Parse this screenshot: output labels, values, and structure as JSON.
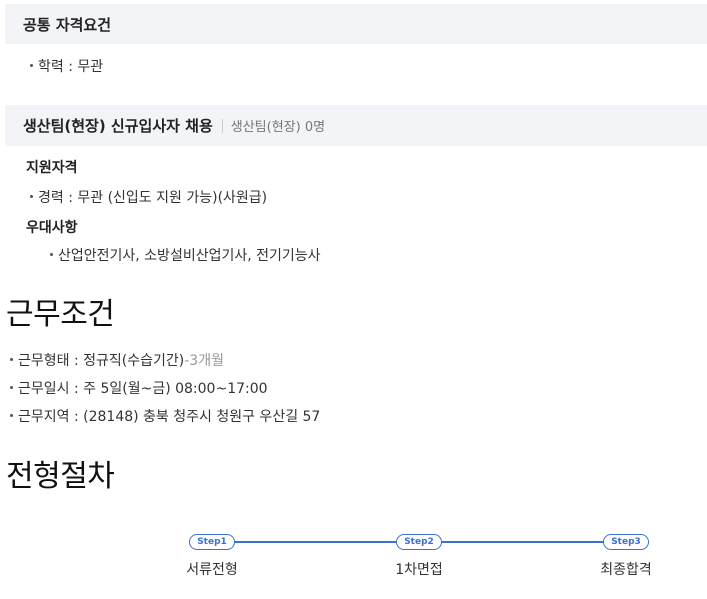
{
  "common": {
    "title": "공통 자격요건",
    "items": [
      "학력 : 무관"
    ]
  },
  "position": {
    "title": "생산팀(현장) 신규입사자 채용",
    "subtitle": "생산팀(현장) 0명",
    "qualification_heading": "지원자격",
    "qualification_items": [
      "경력 : 무관 (신입도 지원 가능)(사원급)"
    ],
    "preference_heading": "우대사항",
    "preference_items": [
      "산업안전기사, 소방설비산업기사, 전기기능사"
    ]
  },
  "conditions": {
    "heading": "근무조건",
    "type_text": "근무형태 : 정규직(수습기간)",
    "type_extra": "-3개월",
    "schedule_text": "근무일시 : 주 5일(월~금) 08:00~17:00",
    "location_text": "근무지역 : (28148) 충북 청주시 청원구 우산길 57"
  },
  "process": {
    "heading": "전형절차",
    "steps": [
      {
        "badge": "Step1",
        "label": "서류전형"
      },
      {
        "badge": "Step2",
        "label": "1차면접"
      },
      {
        "badge": "Step3",
        "label": "최종합격"
      }
    ]
  },
  "colors": {
    "accent": "#3b6fd6",
    "bar_background": "#f3f4f7",
    "muted_text": "#999999"
  }
}
